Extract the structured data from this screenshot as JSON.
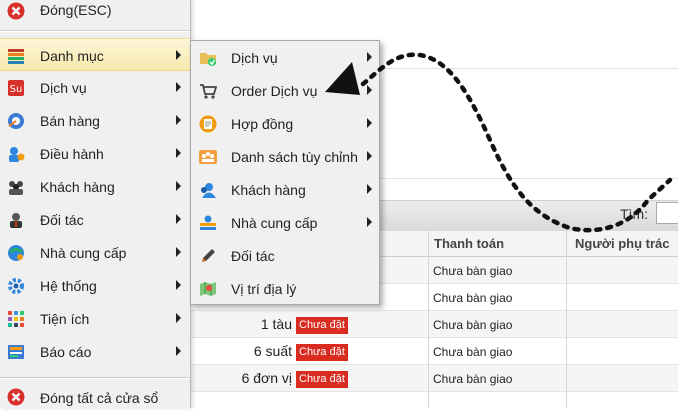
{
  "menu": {
    "close_label": "Đóng(ESC)",
    "items": [
      {
        "label": "Danh mục",
        "icon": "list-icon"
      },
      {
        "label": "Dịch vụ",
        "icon": "service-icon"
      },
      {
        "label": "Bán hàng",
        "icon": "sales-icon"
      },
      {
        "label": "Điều hành",
        "icon": "operation-icon"
      },
      {
        "label": "Khách hàng",
        "icon": "customers-icon"
      },
      {
        "label": "Đối tác",
        "icon": "partner-icon"
      },
      {
        "label": "Nhà cung cấp",
        "icon": "supplier-icon"
      },
      {
        "label": "Hệ thống",
        "icon": "gear-icon"
      },
      {
        "label": "Tiện ích",
        "icon": "apps-icon"
      },
      {
        "label": "Báo cáo",
        "icon": "report-icon"
      }
    ],
    "close_all_label": "Đóng tất cả cửa sổ"
  },
  "submenu": {
    "items": [
      {
        "label": "Dịch vụ",
        "icon": "folder-icon",
        "has_arrow": true
      },
      {
        "label": "Order Dịch vụ",
        "icon": "cart-icon",
        "has_arrow": true
      },
      {
        "label": "Hợp đồng",
        "icon": "contract-icon",
        "has_arrow": true
      },
      {
        "label": "Danh sách tùy chỉnh",
        "icon": "custom-list-icon",
        "has_arrow": true
      },
      {
        "label": "Khách hàng",
        "icon": "customer-icon",
        "has_arrow": true
      },
      {
        "label": "Nhà cung cấp",
        "icon": "supplier-icon",
        "has_arrow": true
      },
      {
        "label": "Đối tác",
        "icon": "pen-icon",
        "has_arrow": false
      },
      {
        "label": "Vị trí địa lý",
        "icon": "map-icon",
        "has_arrow": false
      }
    ]
  },
  "toolbar": {
    "search_label": "Tìm:"
  },
  "grid": {
    "columns": [
      "Thanh toán",
      "Người phụ trác"
    ],
    "rows": [
      {
        "qty": "",
        "status": "",
        "payment": "Chưa bàn giao"
      },
      {
        "qty": "",
        "status": "",
        "payment": "Chưa bàn giao"
      },
      {
        "qty": "1 tàu",
        "status": "Chưa đặt",
        "payment": "Chưa bàn giao"
      },
      {
        "qty": "6 suất",
        "status": "Chưa đặt",
        "payment": "Chưa bàn giao"
      },
      {
        "qty": "6 đơn vị",
        "status": "Chưa đặt",
        "payment": "Chưa bàn giao"
      }
    ]
  },
  "colors": {
    "badge": "#d92b1f",
    "highlight": "#f6e9ac",
    "annotation": "#111111"
  }
}
